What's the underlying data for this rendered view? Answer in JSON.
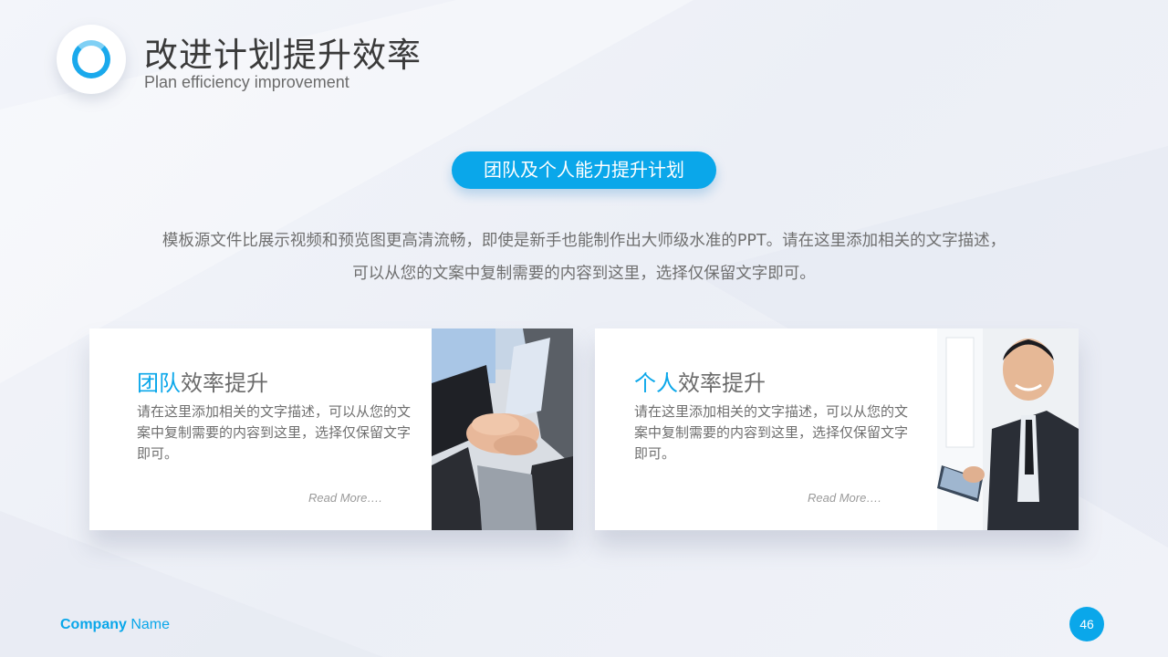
{
  "header": {
    "title": "改进计划提升效率",
    "subtitle": "Plan efficiency improvement"
  },
  "pill": {
    "label": "团队及个人能力提升计划"
  },
  "description": {
    "line1": "模板源文件比展示视频和预览图更高清流畅，即使是新手也能制作出大师级水准的PPT。请在这里添加相关的文字描述，",
    "line2": "可以从您的文案中复制需要的内容到这里，选择仅保留文字即可。"
  },
  "cards": [
    {
      "title_highlight": "团队",
      "title_rest": "效率提升",
      "text": "请在这里添加相关的文字描述，可以从您的文案中复制需要的内容到这里，选择仅保留文字即可。",
      "read_more": "Read More….",
      "photo": "team-hands-photo"
    },
    {
      "title_highlight": "个人",
      "title_rest": "效率提升",
      "text": "请在这里添加相关的文字描述，可以从您的文案中复制需要的内容到这里，选择仅保留文字即可。",
      "read_more": "Read More….",
      "photo": "businessman-tablet-photo"
    }
  ],
  "footer": {
    "company_bold": "Company",
    "company_rest": " Name",
    "page_number": "46"
  },
  "colors": {
    "accent": "#0aa7ea",
    "text": "#6f6f6f",
    "title": "#3a3a3a"
  }
}
